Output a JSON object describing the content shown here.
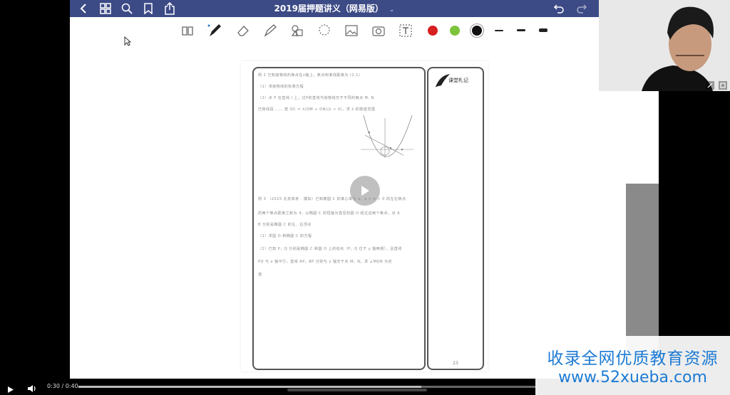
{
  "app": {
    "title": "2019届押题讲义（网易版）",
    "title_chevron": "⌄"
  },
  "colors": {
    "titlebar": "#3c4a86",
    "swatch_red": "#d61f1f",
    "swatch_green": "#7cc43b",
    "swatch_black": "#111111",
    "watermark_text": "#1c7ad3"
  },
  "toolbar": {
    "icons": [
      "back-icon",
      "grid-icon",
      "search-icon",
      "bookmark-icon",
      "share-icon",
      "undo-icon",
      "redo-icon"
    ],
    "tools": [
      "book-icon",
      "pen-icon",
      "eraser-icon",
      "highlighter-icon",
      "shapes-icon",
      "lasso-icon",
      "image-icon",
      "camera-icon",
      "text-icon"
    ]
  },
  "page": {
    "notes_title": "课堂札记",
    "page_number": "23",
    "q_lines": [
      "例 2  已知抛物线的焦点在x轴上，焦点到准线距离为 (2,1)",
      "（1）求抛物线的标准方程",
      "（2）点 P 在直线 l 上，过P的直线与抛物线交于不同的两点 M, N",
      "已知线段 ……  若 OC = λ(OM + ON)(λ > 0)，求 λ 的取值范围",
      "例 3  （2015 北京高考 · 模拟）已知椭圆 C 的离心率为 e，a > b > 0 的左右焦点",
      "的两个焦点距离之和为 4，以椭圆 C 的短轴为直径的圆 O 经过这两个焦点，点 A",
      "B 分别是椭圆 C 的左、右顶点",
      "（1）求圆 O 和椭圆 C 的方程",
      "（2）已知 P，Q 分别是椭圆 C 和圆 O 上的动点（P，Q 位于 y 轴两侧），且直线",
      "PQ 与 x 轴平行，直线 AP，BP 分别与 y 轴交于点 M，N，求 ∠MQN 为定",
      "值"
    ]
  },
  "player": {
    "time": "0:30 / 0:40",
    "progress": 0.75
  },
  "watermark": {
    "line1": "收录全网优质教育资源",
    "line2": "www.52xueba.com"
  }
}
